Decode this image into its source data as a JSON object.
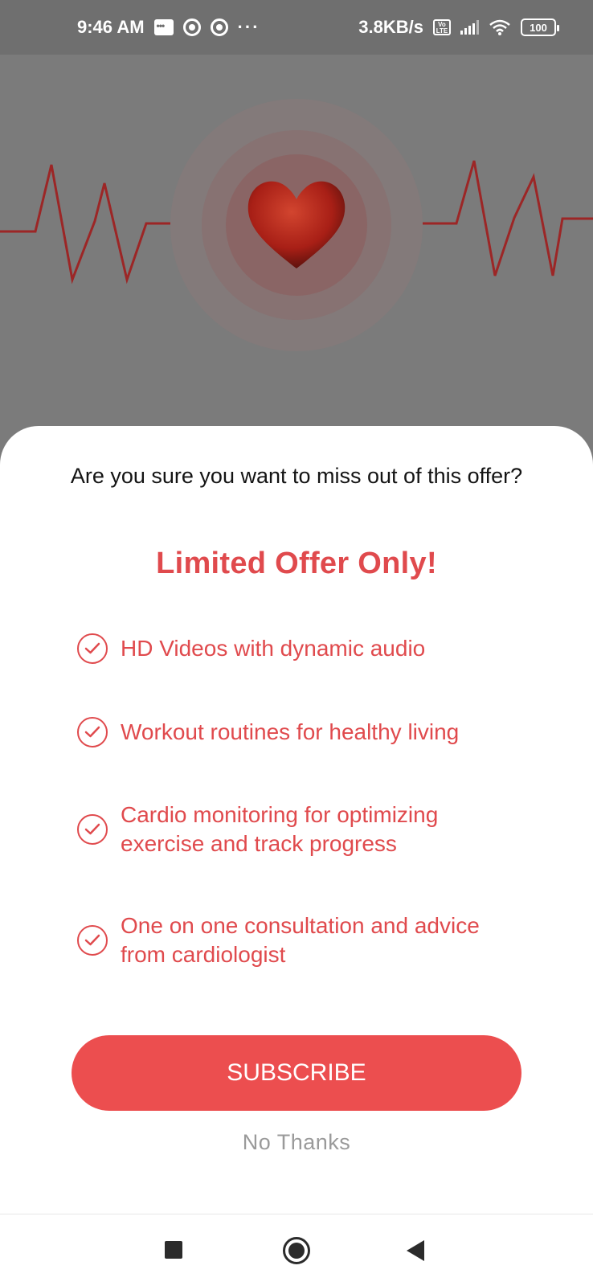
{
  "status_bar": {
    "time": "9:46 AM",
    "network_speed": "3.8KB/s",
    "volte": "Vo LTE",
    "battery": "100",
    "more_dots": "···"
  },
  "hero": {
    "heart_color": "#b3231a",
    "ecg_color": "#9c2626"
  },
  "sheet": {
    "question": "Are you sure you want to miss out of this offer?",
    "title": "Limited Offer Only!",
    "features": [
      "HD Videos with dynamic audio",
      "Workout routines for healthy living",
      "Cardio monitoring for optimizing exercise and track progress",
      "One on one consultation and advice from cardiologist"
    ],
    "subscribe_label": "SUBSCRIBE",
    "no_thanks_label": "No Thanks"
  },
  "colors": {
    "accent": "#e04a4d",
    "button": "#ec4e4f",
    "muted": "#9a9a9a"
  },
  "nav": {
    "icons": [
      "recent-apps-icon",
      "home-icon",
      "back-icon"
    ]
  }
}
